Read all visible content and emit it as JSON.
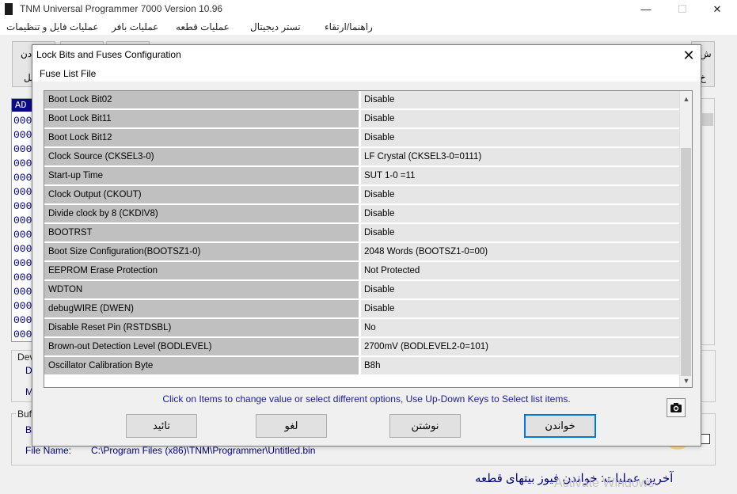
{
  "app": {
    "title": "TNM  Universal Programmer 7000   Version 10.96",
    "window_controls": [
      "—",
      "☐",
      "✕"
    ]
  },
  "menu": [
    "عملیات فایل و تنظیمات",
    "عملیات بافر",
    "عملیات قطعه",
    "تستر دیجیتال",
    "راهنما/ارتقاء"
  ],
  "toolbar_fragments": {
    "left_top": "دن",
    "left_bottom": "یل",
    "right_top": "ش",
    "right_bottom": "خ"
  },
  "hex": {
    "header": "AD",
    "rows": [
      "000",
      "000",
      "000",
      "000",
      "000",
      "000",
      "000",
      "000",
      "000",
      "000",
      "000",
      "000",
      "000",
      "000",
      "000",
      "000"
    ]
  },
  "device_group": {
    "label": "Dev",
    "line1": "D",
    "line2": "M"
  },
  "buffer_group": {
    "label": "Buff",
    "line1": "B"
  },
  "file": {
    "label": "File Name:",
    "value": "C:\\Program Files (x86)\\TNM\\Programmer\\Untitled.bin"
  },
  "last_operation": "آخرین عملیات:  خواندن فیوز بیتهای قطعه",
  "watermark": "Activate Windows",
  "dialog": {
    "title": "Lock Bits and Fuses Configuration",
    "close": "✕",
    "menu_item": "Fuse List File",
    "rows": [
      {
        "name": "Boot Lock Bit02",
        "value": "Disable"
      },
      {
        "name": "Boot Lock Bit11",
        "value": "Disable"
      },
      {
        "name": "Boot Lock Bit12",
        "value": "Disable"
      },
      {
        "name": "Clock Source (CKSEL3-0)",
        "value": "LF Crystal (CKSEL3-0=0111)"
      },
      {
        "name": "Start-up Time",
        "value": "SUT 1-0 =11"
      },
      {
        "name": "Clock Output (CKOUT)",
        "value": "Disable"
      },
      {
        "name": "Divide clock by 8 (CKDIV8)",
        "value": "Disable"
      },
      {
        "name": "BOOTRST",
        "value": "Disable"
      },
      {
        "name": "Boot Size Configuration(BOOTSZ1-0)",
        "value": "2048 Words (BOOTSZ1-0=00)"
      },
      {
        "name": "EEPROM Erase Protection",
        "value": "Not Protected"
      },
      {
        "name": "WDTON",
        "value": "Disable"
      },
      {
        "name": "debugWIRE (DWEN)",
        "value": "Disable"
      },
      {
        "name": "Disable Reset Pin  (RSTDSBL)",
        "value": "No"
      },
      {
        "name": "Brown-out Detection Level (BODLEVEL)",
        "value": "2700mV (BODLEVEL2-0=101)"
      },
      {
        "name": "Oscillator Calibration Byte",
        "value": "B8h"
      }
    ],
    "hint": "Click on Items to change value or select different options, Use Up-Down Keys to Select list items.",
    "buttons": {
      "confirm": "تائید",
      "cancel": "لغو",
      "write": "نوشتن",
      "read": "خواندن"
    },
    "scroll_up": "▲",
    "scroll_down": "▼"
  }
}
